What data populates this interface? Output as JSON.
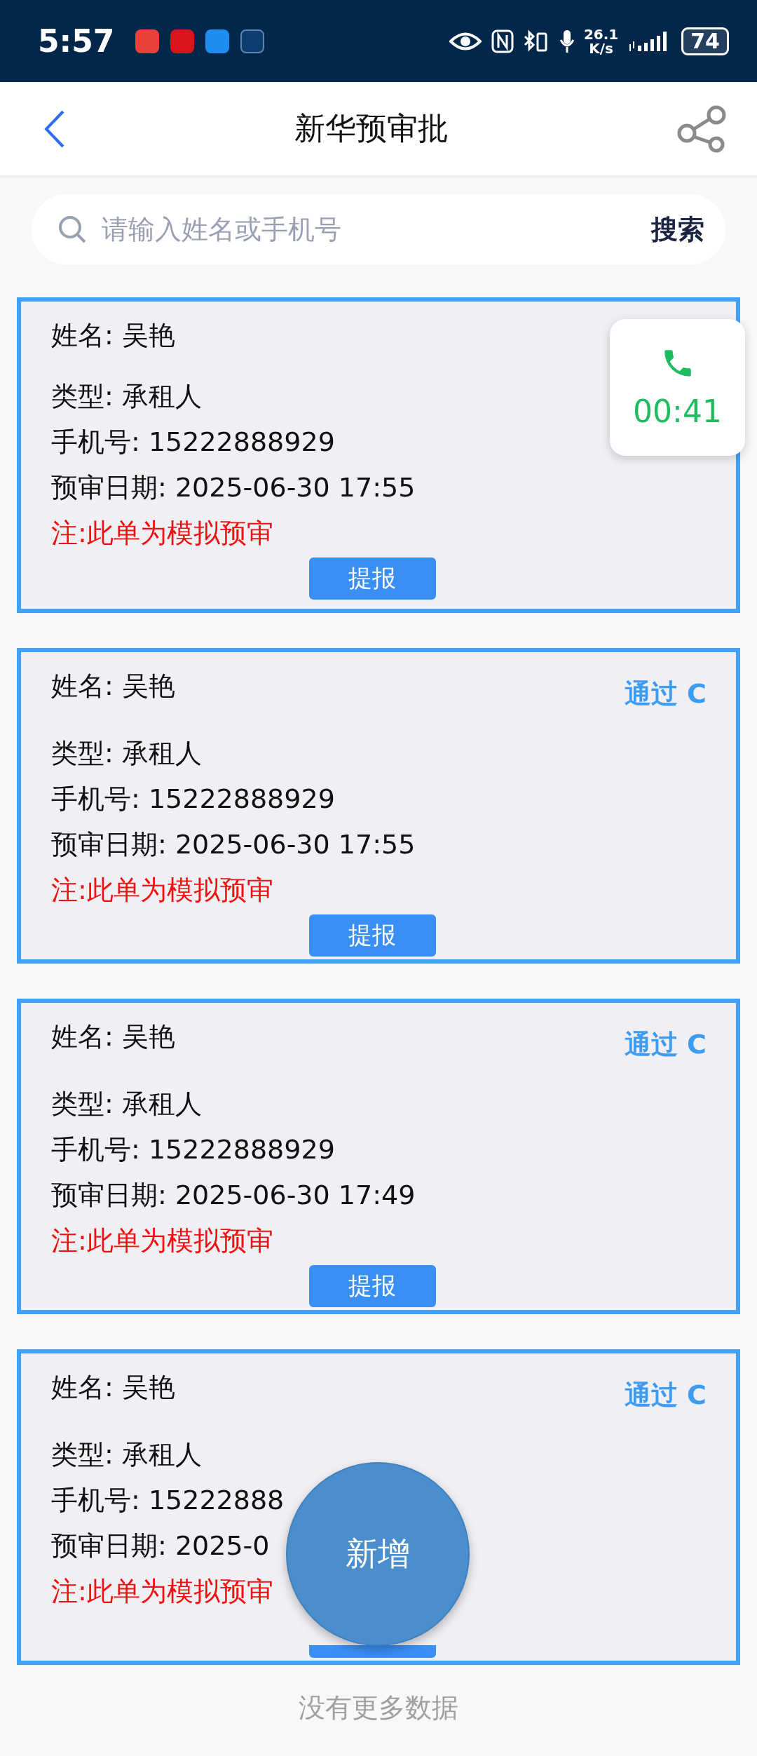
{
  "status_bar": {
    "time": "5:57",
    "speed": "26.1",
    "speed_unit": "K/s",
    "battery": "74"
  },
  "header": {
    "title": "新华预审批"
  },
  "search": {
    "placeholder": "请输入姓名或手机号",
    "button": "搜索"
  },
  "records": [
    {
      "name": "姓名: 吴艳",
      "lines": [
        "类型: 承租人",
        "手机号: 15222888929",
        "预审日期: 2025-06-30 17:55"
      ],
      "note": "注:此单为模拟预审",
      "button": "提报"
    },
    {
      "name": "姓名: 吴艳",
      "status": "通过 C",
      "lines": [
        "类型: 承租人",
        "手机号: 15222888929",
        "预审日期: 2025-06-30 17:55"
      ],
      "note": "注:此单为模拟预审",
      "button": "提报"
    },
    {
      "name": "姓名: 吴艳",
      "status": "通过 C",
      "lines": [
        "类型: 承租人",
        "手机号: 15222888929",
        "预审日期: 2025-06-30 17:49"
      ],
      "note": "注:此单为模拟预审",
      "button": "提报"
    },
    {
      "name": "姓名: 吴艳",
      "status": "通过 C",
      "lines": [
        "类型: 承租人",
        "手机号: 15222888",
        "预审日期: 2025-0"
      ],
      "note": "注:此单为模拟预审"
    }
  ],
  "call_overlay": {
    "timer": "00:41"
  },
  "fab": {
    "label": "新增"
  },
  "footer": "没有更多数据"
}
